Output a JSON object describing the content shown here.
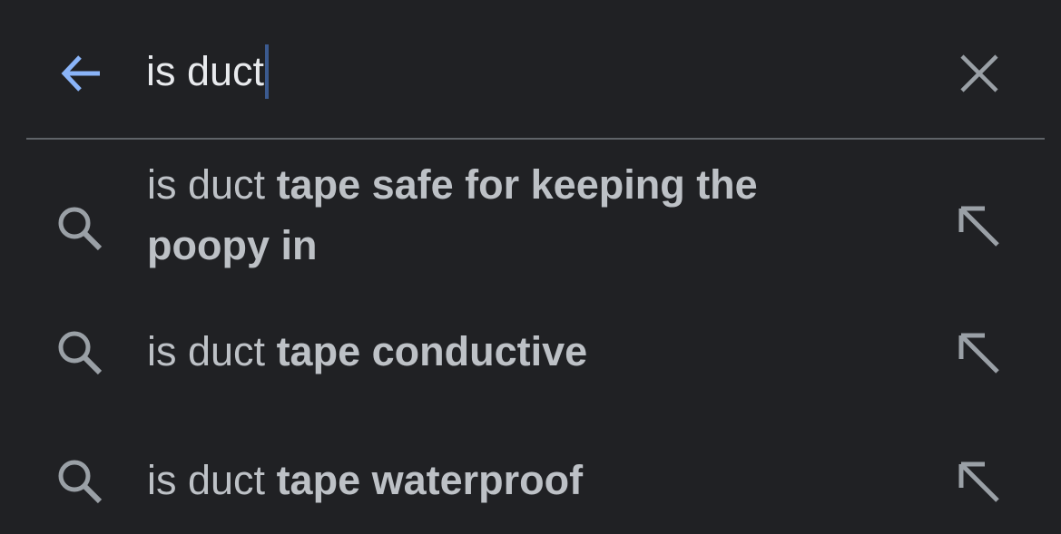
{
  "search": {
    "query": "is duct",
    "back_icon": "arrow-left-icon",
    "clear_icon": "close-icon"
  },
  "suggestions": [
    {
      "prefix": "is duct ",
      "completion": "tape safe for keeping the poopy in"
    },
    {
      "prefix": "is duct ",
      "completion": "tape conductive"
    },
    {
      "prefix": "is duct ",
      "completion": "tape waterproof"
    }
  ],
  "icons": {
    "suggestion_icon": "search-icon",
    "fill_icon": "arrow-up-left-icon"
  },
  "colors": {
    "background": "#202124",
    "accent": "#8ab4f8",
    "text": "#e8eaed",
    "secondary_text": "#bdc1c6",
    "icon": "#9aa0a6",
    "divider": "#5f6368",
    "caret": "#3b5a8f"
  }
}
